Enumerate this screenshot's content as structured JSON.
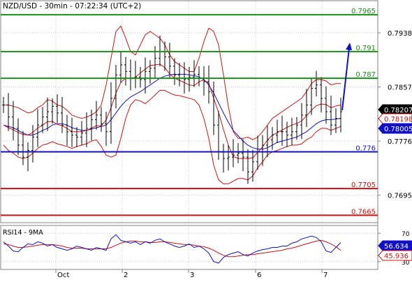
{
  "header": {
    "symbol": "NZD/USD",
    "timeframe": "30min",
    "time": "07:22:34",
    "timezone": "(UTC+2)",
    "title_text": "NZD/USD - 30min - 07:22:34 (UTC+2)"
  },
  "colors": {
    "resistance": "#189018",
    "support_blue": "#1010c8",
    "support_red": "#d01010",
    "candles": "#000000",
    "bollinger": "#d01010",
    "ma": "#1010c8",
    "forecast_arrow": "#1010c8",
    "rsi_line": "#1010c8",
    "rsi_ma": "#d01010",
    "grid": "#c8c8c8"
  },
  "chart_data": [
    {
      "type": "line",
      "name": "price",
      "ylim": [
        0.7655,
        0.7985
      ],
      "y_ticks": [
        "0.7938",
        "0.7857",
        "0.7776",
        "0.7695"
      ],
      "x_ticks": [
        "Oct",
        "2",
        "3",
        "6",
        "7"
      ],
      "levels": [
        {
          "value": 0.7965,
          "label": "0.7965",
          "kind": "resistance"
        },
        {
          "value": 0.791,
          "label": "0.791",
          "kind": "resistance"
        },
        {
          "value": 0.787,
          "label": "0.787",
          "kind": "resistance"
        },
        {
          "value": 0.776,
          "label": "0.776",
          "kind": "support_blue"
        },
        {
          "value": 0.7705,
          "label": "0.7705",
          "kind": "support_red"
        },
        {
          "value": 0.7665,
          "label": "0.7665",
          "kind": "support_red"
        }
      ],
      "price_tags": [
        {
          "value": 0.78207,
          "label": "0.78207",
          "style": "dark"
        },
        {
          "value": 0.78198,
          "label": "0.78198",
          "style": "red"
        },
        {
          "value": 0.78005,
          "label": "0.78005",
          "style": "blue"
        }
      ],
      "close_series": [
        0.783,
        0.7812,
        0.7795,
        0.777,
        0.7752,
        0.7762,
        0.7782,
        0.78,
        0.7812,
        0.782,
        0.7828,
        0.7818,
        0.78,
        0.779,
        0.7785,
        0.7782,
        0.7788,
        0.7795,
        0.7808,
        0.7815,
        0.7802,
        0.779,
        0.784,
        0.7875,
        0.789,
        0.788,
        0.787,
        0.7872,
        0.7868,
        0.788,
        0.7885,
        0.79,
        0.791,
        0.7902,
        0.7888,
        0.7875,
        0.787,
        0.7868,
        0.7872,
        0.7876,
        0.787,
        0.7865,
        0.785,
        0.78,
        0.776,
        0.775,
        0.7752,
        0.7755,
        0.7758,
        0.7752,
        0.773,
        0.7745,
        0.776,
        0.777,
        0.7778,
        0.7785,
        0.779,
        0.779,
        0.7785,
        0.779,
        0.78,
        0.7815,
        0.783,
        0.7855,
        0.786,
        0.784,
        0.782,
        0.78,
        0.781,
        0.782
      ],
      "bollinger_upper": [
        0.783,
        0.783,
        0.7828,
        0.7826,
        0.7822,
        0.7818,
        0.782,
        0.7826,
        0.783,
        0.7838,
        0.7836,
        0.783,
        0.7828,
        0.7822,
        0.7815,
        0.7812,
        0.781,
        0.7812,
        0.7815,
        0.782,
        0.783,
        0.786,
        0.79,
        0.794,
        0.7948,
        0.793,
        0.791,
        0.7905,
        0.792,
        0.7935,
        0.794,
        0.7935,
        0.793,
        0.792,
        0.7905,
        0.7895,
        0.789,
        0.7885,
        0.788,
        0.788,
        0.79,
        0.7925,
        0.7945,
        0.794,
        0.792,
        0.7875,
        0.7828,
        0.779,
        0.778,
        0.778,
        0.7782,
        0.7778,
        0.7782,
        0.779,
        0.78,
        0.781,
        0.7815,
        0.782,
        0.7825,
        0.783,
        0.7835,
        0.784,
        0.785,
        0.7862,
        0.7868,
        0.7868,
        0.7866,
        0.786,
        0.7862,
        0.7862
      ],
      "bollinger_lower": [
        0.777,
        0.7762,
        0.7758,
        0.7752,
        0.775,
        0.7752,
        0.7758,
        0.7765,
        0.777,
        0.7772,
        0.7775,
        0.7772,
        0.777,
        0.7768,
        0.7765,
        0.7768,
        0.777,
        0.7772,
        0.7776,
        0.7778,
        0.7768,
        0.7755,
        0.7752,
        0.7755,
        0.778,
        0.781,
        0.783,
        0.7838,
        0.7836,
        0.7832,
        0.7838,
        0.7845,
        0.7852,
        0.7852,
        0.7848,
        0.7845,
        0.7844,
        0.7842,
        0.784,
        0.7838,
        0.783,
        0.781,
        0.778,
        0.774,
        0.7718,
        0.7712,
        0.7712,
        0.7716,
        0.772,
        0.772,
        0.7718,
        0.7724,
        0.7736,
        0.7745,
        0.7755,
        0.776,
        0.7762,
        0.7765,
        0.7768,
        0.777,
        0.777,
        0.7772,
        0.7778,
        0.7782,
        0.779,
        0.7795,
        0.7795,
        0.7792,
        0.7795,
        0.7798
      ],
      "moving_average": [
        0.78,
        0.7798,
        0.7796,
        0.7792,
        0.7788,
        0.7785,
        0.7785,
        0.7788,
        0.7792,
        0.7795,
        0.78,
        0.7802,
        0.7802,
        0.78,
        0.7796,
        0.7794,
        0.7792,
        0.7792,
        0.7794,
        0.7796,
        0.7798,
        0.78,
        0.7808,
        0.7818,
        0.7828,
        0.7836,
        0.7842,
        0.7846,
        0.785,
        0.7855,
        0.786,
        0.7865,
        0.787,
        0.7873,
        0.7875,
        0.7876,
        0.7876,
        0.7876,
        0.7875,
        0.7874,
        0.7872,
        0.7868,
        0.786,
        0.7848,
        0.7833,
        0.7818,
        0.7804,
        0.7792,
        0.7784,
        0.7776,
        0.777,
        0.7766,
        0.7764,
        0.7764,
        0.7766,
        0.777,
        0.7774,
        0.7776,
        0.7778,
        0.778,
        0.7782,
        0.7786,
        0.779,
        0.7796,
        0.7802,
        0.7806,
        0.7808,
        0.7808,
        0.7809,
        0.781
      ],
      "forecast_target": 0.7915
    },
    {
      "type": "line",
      "name": "rsi",
      "label": "RSI14 - 9MA",
      "ylim": [
        20,
        80
      ],
      "y_ticks": [
        "70",
        "30"
      ],
      "tags": [
        {
          "value": 56.634,
          "label": "56.634",
          "style": "blue"
        },
        {
          "value": 45.936,
          "label": "45.936",
          "style": "red"
        }
      ],
      "rsi_series": [
        58,
        52,
        45,
        44,
        50,
        55,
        54,
        58,
        56,
        52,
        54,
        50,
        48,
        46,
        48,
        52,
        50,
        48,
        46,
        50,
        48,
        46,
        62,
        68,
        60,
        58,
        56,
        58,
        54,
        58,
        56,
        60,
        62,
        58,
        55,
        52,
        50,
        52,
        55,
        50,
        52,
        48,
        42,
        30,
        28,
        36,
        40,
        42,
        44,
        40,
        38,
        42,
        45,
        47,
        48,
        50,
        50,
        52,
        52,
        56,
        58,
        62,
        64,
        66,
        64,
        58,
        45,
        43,
        50,
        57
      ],
      "rsi_ma_series": [
        55,
        54,
        52,
        50,
        50,
        51,
        52,
        53,
        54,
        54,
        54,
        53,
        52,
        50,
        49,
        49,
        49,
        48,
        48,
        48,
        48,
        48,
        50,
        53,
        56,
        58,
        59,
        59,
        58,
        58,
        57,
        57,
        58,
        58,
        57,
        56,
        55,
        54,
        54,
        53,
        52,
        51,
        49,
        46,
        42,
        39,
        37,
        37,
        38,
        39,
        40,
        40,
        41,
        42,
        43,
        44,
        45,
        46,
        48,
        49,
        51,
        53,
        55,
        57,
        59,
        60,
        58,
        55,
        51,
        46
      ]
    }
  ]
}
